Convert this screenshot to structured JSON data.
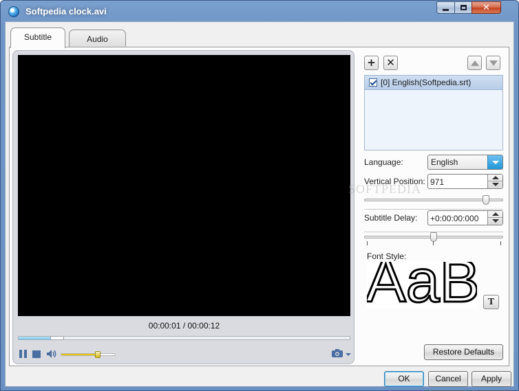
{
  "window": {
    "title": "Softpedia clock.avi"
  },
  "tabs": [
    {
      "label": "Subtitle"
    },
    {
      "label": "Audio"
    }
  ],
  "player": {
    "time_display": "00:00:01 / 00:00:12",
    "seek_progress_fraction": 0.08,
    "volume_fraction": 0.68
  },
  "subtitles": {
    "items": [
      {
        "label": "[0] English(Softpedia.srt)",
        "checked": true
      }
    ]
  },
  "settings": {
    "language_label": "Language:",
    "language_value": "English",
    "vertical_position_label": "Vertical Position:",
    "vertical_position_value": "971",
    "vertical_position_slider_fraction": 0.88,
    "subtitle_delay_label": "Subtitle Delay:",
    "subtitle_delay_value": "+0:00:00:000",
    "subtitle_delay_slider_fraction": 0.5,
    "font_style_label": "Font Style:",
    "font_sample_text": "AaB",
    "font_button_label": "T"
  },
  "buttons": {
    "restore_defaults": "Restore Defaults",
    "ok": "OK",
    "cancel": "Cancel",
    "apply": "Apply"
  },
  "watermark": "SOFTPEDIA",
  "colors": {
    "titlebar": "#7aa0cf",
    "accent_blue": "#2196d8",
    "volume_yellow": "#e8c70d",
    "video_background": "#000000"
  },
  "icons": {
    "app": "globe-icon",
    "pause": "pause-icon",
    "stop": "stop-icon",
    "volume": "speaker-icon",
    "snapshot": "camera-icon"
  }
}
